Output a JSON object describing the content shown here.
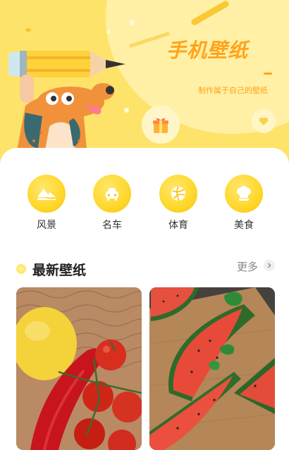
{
  "banner": {
    "title": "手机壁纸",
    "subtitle": "制作属于自己的壁纸"
  },
  "categories": [
    {
      "label": "风景",
      "icon": "landscape-icon"
    },
    {
      "label": "名车",
      "icon": "car-icon"
    },
    {
      "label": "体育",
      "icon": "ball-icon"
    },
    {
      "label": "美食",
      "icon": "chef-hat-icon"
    }
  ],
  "section": {
    "title": "最新壁纸",
    "more": "更多"
  },
  "colors": {
    "banner_bg": "#fde36a",
    "accent": "#ffa31a",
    "category_icon": "#ffd92f"
  }
}
